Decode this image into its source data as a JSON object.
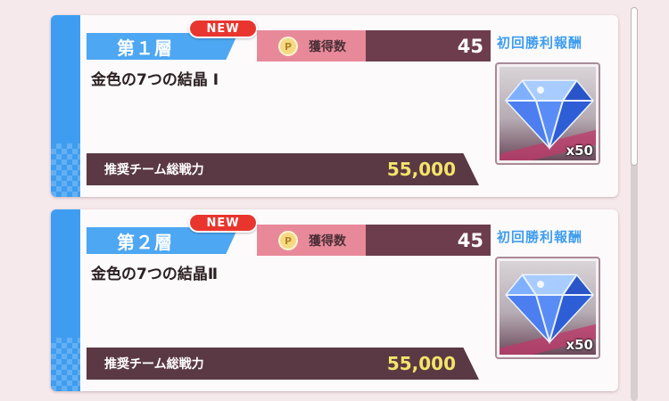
{
  "cards": [
    {
      "floor_label": "第１層",
      "new_badge": "NEW",
      "points_icon": "P",
      "points_label": "獲得数",
      "points_value": "45",
      "stage_name": "金色の7つの結晶 Ⅰ",
      "power_label": "推奨チーム総戦力",
      "power_value": "55,000",
      "reward_title": "初回勝利報酬",
      "reward_icon": "diamond-icon",
      "reward_count": "x50"
    },
    {
      "floor_label": "第２層",
      "new_badge": "NEW",
      "points_icon": "P",
      "points_label": "獲得数",
      "points_value": "45",
      "stage_name": "金色の7つの結晶Ⅱ",
      "power_label": "推奨チーム総戦力",
      "power_value": "55,000",
      "reward_title": "初回勝利報酬",
      "reward_icon": "diamond-icon",
      "reward_count": "x50"
    }
  ],
  "colors": {
    "accent_blue": "#3e9df0",
    "new_red": "#e8362f",
    "points_pink": "#e8899a",
    "dark_plum": "#6d3d4d",
    "power_yellow": "#f4e46a"
  }
}
